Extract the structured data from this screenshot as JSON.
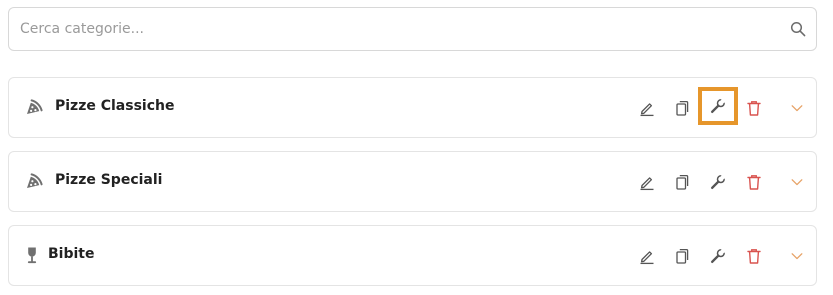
{
  "search": {
    "placeholder": "Cerca categorie..."
  },
  "categories": [
    {
      "name": "Pizze Classiche",
      "icon": "pizza-icon"
    },
    {
      "name": "Pizze Speciali",
      "icon": "pizza-icon"
    },
    {
      "name": "Bibite",
      "icon": "wine-glass-icon"
    }
  ],
  "actions": [
    "pencil-icon",
    "copy-icon",
    "wrench-icon",
    "trash-icon",
    "chevron-down-icon"
  ],
  "highlight": {
    "category": 0,
    "action": "wrench-icon"
  },
  "colors": {
    "action_icon": "#555555",
    "category_icon": "#707070",
    "delete": "#d9534f",
    "chevron": "#e7a266",
    "highlight": "#e6962b"
  }
}
